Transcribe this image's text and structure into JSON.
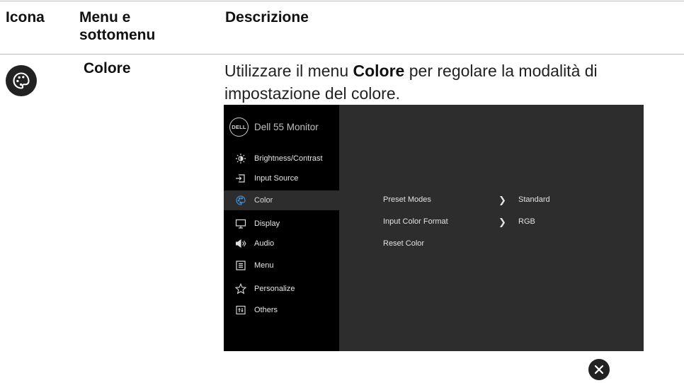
{
  "table": {
    "headers": {
      "icon": "Icona",
      "menu": "Menu e sottomenu",
      "description": "Descrizione"
    },
    "row": {
      "icon": "palette-icon",
      "menu": "Colore",
      "description_before": "Utilizzare il menu ",
      "description_bold": "Colore",
      "description_after": " per regolare la modalità di impostazione del colore."
    }
  },
  "osd": {
    "brand_logo": "DELL",
    "title": "Dell 55 Monitor",
    "menu": [
      {
        "label": "Brightness/Contrast",
        "icon": "brightness-icon"
      },
      {
        "label": "Input Source",
        "icon": "input-source-icon"
      },
      {
        "label": "Color",
        "icon": "palette-icon",
        "active": true
      },
      {
        "label": "Display",
        "icon": "display-icon"
      },
      {
        "label": "Audio",
        "icon": "speaker-icon"
      },
      {
        "label": "Menu",
        "icon": "menu-icon"
      },
      {
        "label": "Personalize",
        "icon": "star-icon"
      },
      {
        "label": "Others",
        "icon": "others-icon"
      }
    ],
    "options": [
      {
        "label": "Preset Modes",
        "value": "Standard"
      },
      {
        "label": "Input Color Format",
        "value": "RGB"
      },
      {
        "label": "Reset Color"
      }
    ],
    "colors": {
      "accent": "#3d8fd9",
      "sidebar_bg": "#000000",
      "panel_bg": "#2d2d2d"
    }
  },
  "close_icon": "close-icon"
}
